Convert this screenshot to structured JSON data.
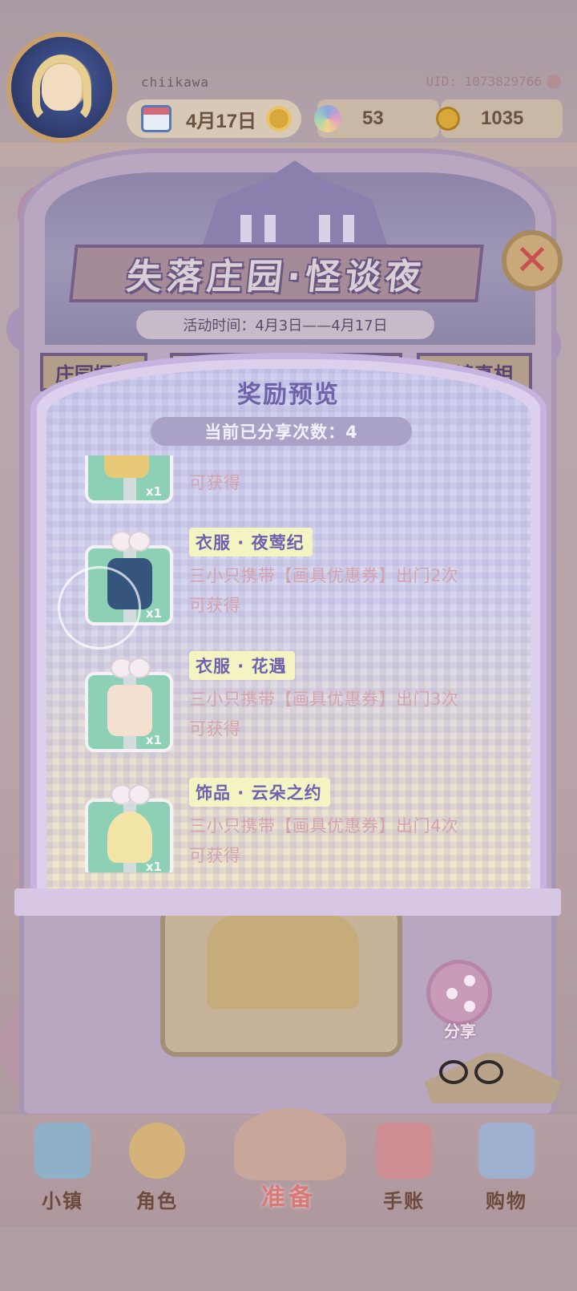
{
  "header": {
    "username": "chiikawa",
    "uid": "UID: 1073829766",
    "date": "4月17日",
    "flowers": "53",
    "coins": "1035"
  },
  "event": {
    "title": "失落庄园·怪谈夜",
    "time": "活动时间：4月3日——4月17日",
    "tabs": [
      "庄园探秘",
      "",
      "解读真相"
    ],
    "share_button": "分享"
  },
  "modal": {
    "title": "奖励预览",
    "share_count": "当前已分享次数：4",
    "items": [
      {
        "name": "",
        "desc_line1": "",
        "desc_line2": "可获得",
        "qty": "x1"
      },
      {
        "name": "衣服 · 夜莺纪",
        "desc_line1": "三小只携带【画具优惠券】出门2次",
        "desc_line2": "可获得",
        "qty": "x1"
      },
      {
        "name": "衣服 · 花遇",
        "desc_line1": "三小只携带【画具优惠券】出门3次",
        "desc_line2": "可获得",
        "qty": "x1"
      },
      {
        "name": "饰品 · 云朵之约",
        "desc_line1": "三小只携带【画具优惠券】出门4次",
        "desc_line2": "可获得",
        "qty": "x1"
      }
    ]
  },
  "nav": {
    "town": "小镇",
    "character": "角色",
    "prepare": "准备",
    "journal": "手账",
    "shop": "购物"
  },
  "colors": {
    "modal_title": "#6e63a8",
    "gift_box": "#8ed0b6",
    "item_name_bg": "#f4f3c2",
    "close_x": "#c9514f"
  },
  "icons": [
    "calendar-icon",
    "sun-icon",
    "flower-icon",
    "coin-icon",
    "close-icon",
    "share-icon",
    "map-icon",
    "character-icon",
    "prepare-icon",
    "journal-icon",
    "shopping-bag-icon"
  ]
}
